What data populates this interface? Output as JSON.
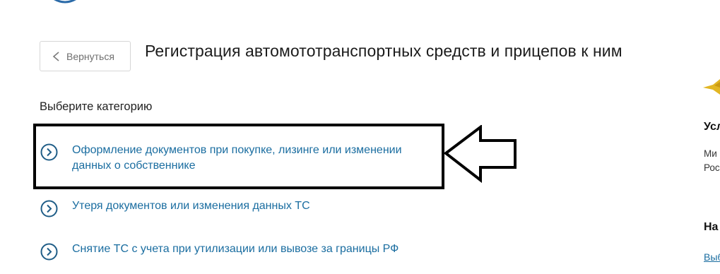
{
  "header": {
    "back_label": "Вернуться",
    "title": "Регистрация автомототранспортных средств и прицепов к ним"
  },
  "main": {
    "category_label": "Выберите категорию",
    "options": [
      {
        "line1": "Оформление документов при покупке, лизинге или изменении",
        "line2": "данных о собственнике",
        "highlighted": true
      },
      {
        "line1": "Утеря документов или изменения данных ТС",
        "line2": "",
        "highlighted": false
      },
      {
        "line1": "Снятие ТС с учета при утилизации или вывозе за границы РФ",
        "line2": "",
        "highlighted": false
      }
    ]
  },
  "sidebar": {
    "heading1": "Усл",
    "text_line1": "Ми",
    "text_line2": "Рос",
    "heading2": "На",
    "link": "Выб"
  },
  "colors": {
    "link": "#1a6da0",
    "emblem_gold": "#e2b623",
    "annotation": "#000000"
  },
  "icons": [
    "back-chevron-icon",
    "circle-chevron-right-icon",
    "annotation-arrow-icon",
    "emblem-icon"
  ]
}
